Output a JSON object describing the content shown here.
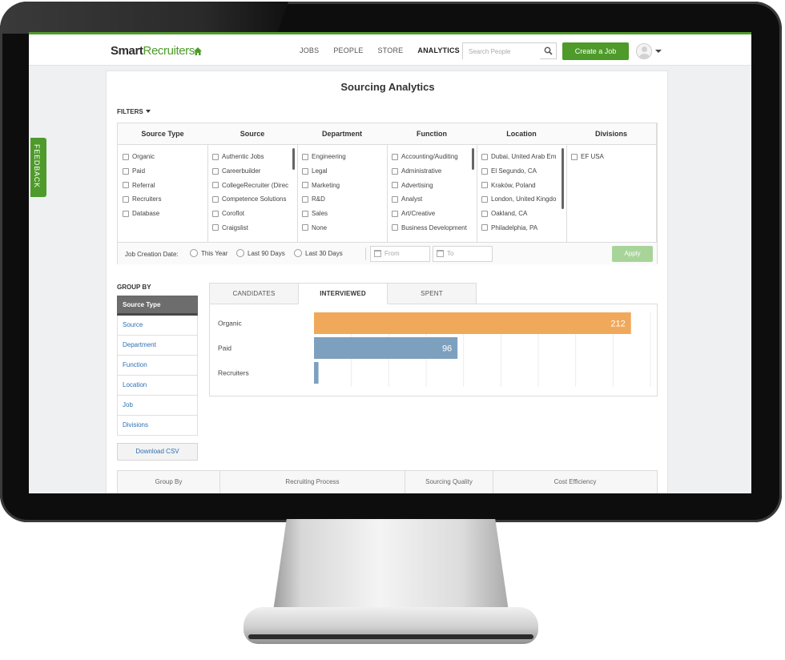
{
  "app": {
    "logo_part1": "Smart",
    "logo_part2": "Recruiters",
    "nav": [
      "JOBS",
      "PEOPLE",
      "STORE",
      "ANALYTICS"
    ],
    "nav_active": "ANALYTICS",
    "search_placeholder": "Search People",
    "create_job_label": "Create a Job",
    "feedback_label": "FEEDBACK",
    "brand_color": "#4e9a2b"
  },
  "page": {
    "title": "Sourcing Analytics",
    "filters_label": "FILTERS"
  },
  "filters": {
    "columns": [
      {
        "header": "Source Type",
        "items": [
          "Organic",
          "Paid",
          "Referral",
          "Recruiters",
          "Database"
        ]
      },
      {
        "header": "Source",
        "items": [
          "Authentic Jobs",
          "Careerbuilder",
          "CollegeRecruiter (Direc",
          "Competence Solutions",
          "Coroflot",
          "Craigslist"
        ]
      },
      {
        "header": "Department",
        "items": [
          "Engineering",
          "Legal",
          "Marketing",
          "R&D",
          "Sales",
          "None"
        ]
      },
      {
        "header": "Function",
        "items": [
          "Accounting/Auditing",
          "Administrative",
          "Advertising",
          "Analyst",
          "Art/Creative",
          "Business Development"
        ]
      },
      {
        "header": "Location",
        "items": [
          "Dubai, United Arab Em",
          "El Segundo, CA",
          "Kraków, Poland",
          "London, United Kingdo",
          "Oakland, CA",
          "Philadelphia, PA"
        ]
      },
      {
        "header": "Divisions",
        "items": [
          "EF USA"
        ]
      }
    ],
    "job_creation_label": "Job Creation Date:",
    "radios": [
      "This Year",
      "Last 90 Days",
      "Last 30 Days"
    ],
    "from_placeholder": "From",
    "to_placeholder": "To",
    "apply_label": "Apply"
  },
  "group_by": {
    "label": "GROUP BY",
    "items": [
      "Source Type",
      "Source",
      "Department",
      "Function",
      "Location",
      "Job",
      "Divisions"
    ],
    "active": "Source Type",
    "download_label": "Download CSV"
  },
  "chart_tabs": [
    "CANDIDATES",
    "INTERVIEWED",
    "SPENT"
  ],
  "chart_tab_active": "INTERVIEWED",
  "chart_data": {
    "type": "bar",
    "orientation": "horizontal",
    "categories": [
      "Organic",
      "Paid",
      "Recruiters"
    ],
    "values": [
      212,
      96,
      3
    ],
    "xlim": [
      0,
      225
    ],
    "grid": true,
    "colors": [
      "#f0a85a",
      "#7ea0bf",
      "#7ea0bf"
    ]
  },
  "bottom_tabs": [
    "Group By",
    "Recruiting Process",
    "Sourcing Quality",
    "Cost Efficiency"
  ]
}
